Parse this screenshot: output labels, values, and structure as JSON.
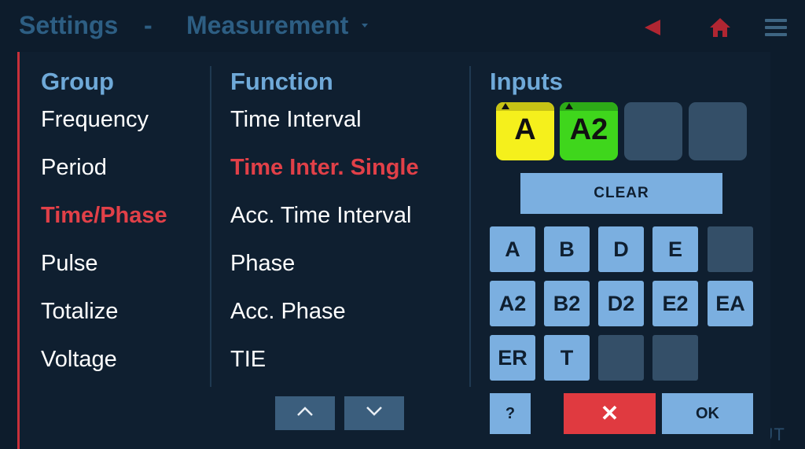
{
  "header": {
    "title": "Settings",
    "separator": "-",
    "section": "Measurement"
  },
  "footer": {
    "about_label": "ABOUT"
  },
  "group": {
    "heading": "Group",
    "items": [
      "Frequency",
      "Period",
      "Time/Phase",
      "Pulse",
      "Totalize",
      "Voltage"
    ],
    "selected": "Time/Phase"
  },
  "function": {
    "heading": "Function",
    "items": [
      "Time Interval",
      "Time Inter. Single",
      "Acc. Time Interval",
      "Phase",
      "Acc. Phase",
      "TIE"
    ],
    "selected": "Time Inter. Single"
  },
  "inputs": {
    "heading": "Inputs",
    "selected_slots": [
      {
        "label": "A",
        "color": "#f5f01c"
      },
      {
        "label": "A2",
        "color": "#3fd61c"
      },
      {
        "label": "",
        "color": "#344f68"
      },
      {
        "label": "",
        "color": "#344f68"
      }
    ],
    "clear_label": "CLEAR",
    "grid": [
      [
        "A",
        "B",
        "D",
        "E",
        ""
      ],
      [
        "A2",
        "B2",
        "D2",
        "E2",
        "EA"
      ],
      [
        "ER",
        "T",
        "",
        ""
      ]
    ]
  },
  "buttons": {
    "help_label": "?",
    "cancel_label": "✕",
    "ok_label": "OK"
  },
  "colors": {
    "accent_red": "#e14048",
    "heading_blue": "#6fa9d8",
    "button_blue": "#7bafe0"
  }
}
